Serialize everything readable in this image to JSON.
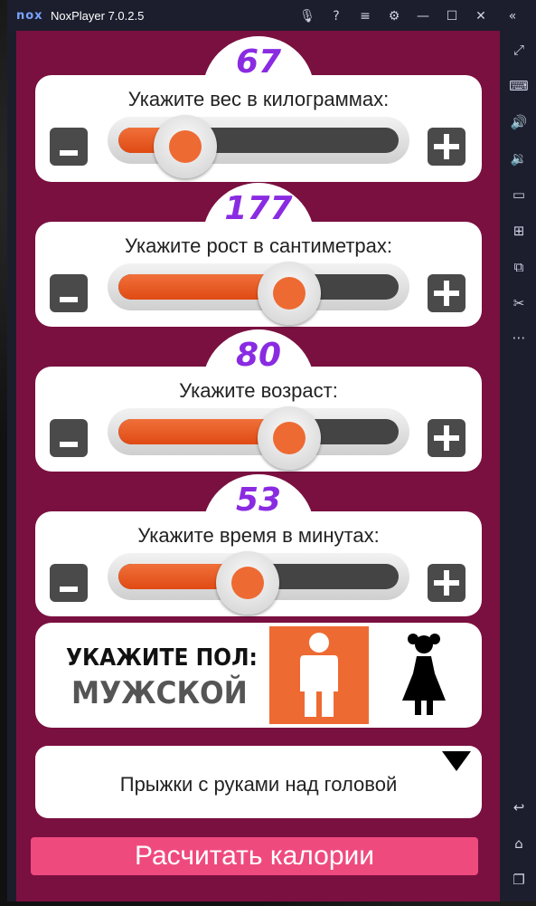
{
  "window": {
    "logo": "nox",
    "title": "NoxPlayer 7.0.2.5",
    "titlebar_icons": [
      "microphone-icon",
      "help-icon",
      "menu-icon",
      "settings-icon",
      "minimize-icon",
      "maximize-icon",
      "close-icon",
      "collapse-icon"
    ],
    "sidebar_icons": [
      "fullscreen-icon",
      "keyboard-icon",
      "volume-up-icon",
      "volume-down-icon",
      "screen-icon",
      "apk-install-icon",
      "multi-instance-icon",
      "scissors-icon",
      "more-icon",
      "back-icon",
      "home-icon",
      "recent-apps-icon"
    ]
  },
  "colors": {
    "app_background": "#7a1040",
    "accent": "#ee6a33",
    "value_color": "#8a2be2",
    "button_color": "#ef4a7e"
  },
  "sliders": [
    {
      "value": "67",
      "label": "Укажите вес в килограммах:",
      "fraction": 0.24
    },
    {
      "value": "177",
      "label": "Укажите рост в сантиметрах:",
      "fraction": 0.61
    },
    {
      "value": "80",
      "label": "Укажите возраст:",
      "fraction": 0.61
    },
    {
      "value": "53",
      "label": "Укажите время в минутах:",
      "fraction": 0.46
    }
  ],
  "gender": {
    "title": "УКАЖИТЕ ПОЛ:",
    "value": "МУЖСКОЙ",
    "selected": "male"
  },
  "exercise": {
    "selected": "Прыжки с руками над головой"
  },
  "calculate_button": "Расчитать калории"
}
